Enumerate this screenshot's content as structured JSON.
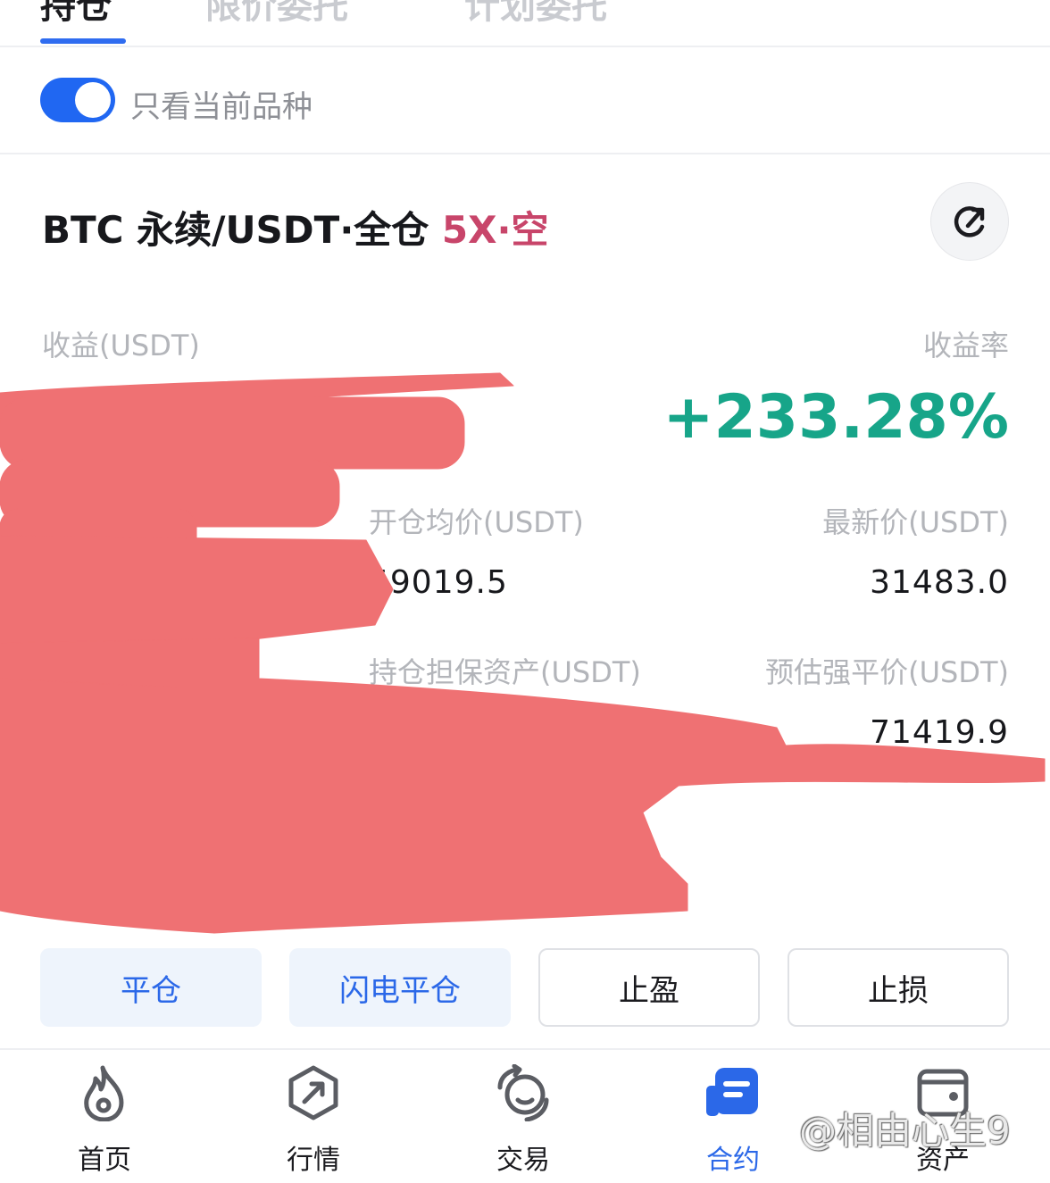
{
  "tabs": [
    {
      "label": "持仓"
    },
    {
      "label": "限价委托"
    },
    {
      "label": "计划委托"
    }
  ],
  "filter": {
    "label": "只看当前品种",
    "enabled": true
  },
  "position": {
    "title": "BTC 永续/USDT·全仓",
    "side": "5X·空",
    "pnl_label": "收益(USDT)",
    "roe_label": "收益率",
    "roe_value": "+233.28%",
    "entry_price_label": "开仓均价(USDT)",
    "entry_price": "59019.5",
    "last_price_label": "最新价(USDT)",
    "last_price": "31483.0",
    "margin_label": "持仓担保资产(USDT)",
    "liq_price_label": "预估强平价(USDT)",
    "liq_price": "71419.9"
  },
  "actions": {
    "close": "平仓",
    "flash_close": "闪电平仓",
    "take_profit": "止盈",
    "stop_loss": "止损"
  },
  "nav": [
    {
      "label": "首页",
      "icon": "flame-icon"
    },
    {
      "label": "行情",
      "icon": "market-hexagon-icon"
    },
    {
      "label": "交易",
      "icon": "trade-exchange-icon"
    },
    {
      "label": "合约",
      "icon": "contract-icon",
      "active": true
    },
    {
      "label": "资产",
      "icon": "wallet-icon"
    }
  ],
  "watermark": "@相由心生9",
  "colors": {
    "accent": "#2b68e8",
    "short": "#c8456a",
    "profit": "#17a589",
    "redaction": "#ef7173"
  }
}
